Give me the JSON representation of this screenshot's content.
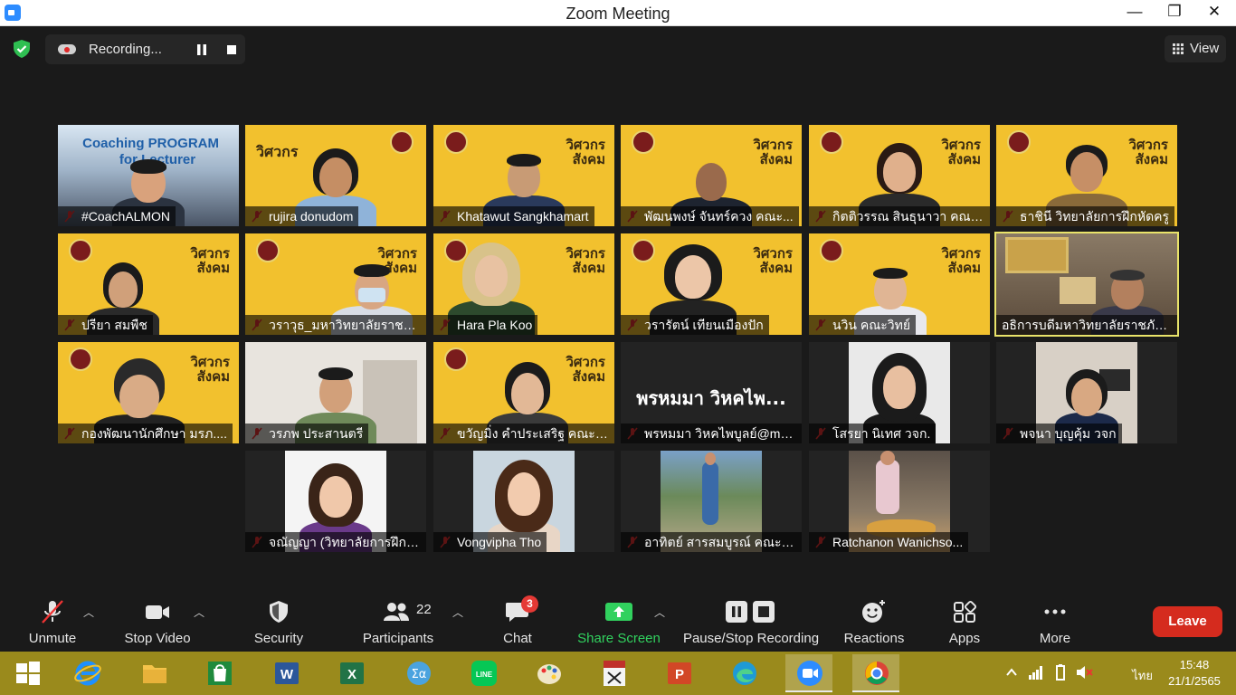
{
  "window": {
    "title": "Zoom Meeting",
    "minimize": "—",
    "maximize": "❐",
    "close": "✕"
  },
  "top": {
    "recording_label": "Recording...",
    "view_label": "View"
  },
  "tiles": [
    {
      "name": "#CoachALMON",
      "overlay1": "Coaching PROGRAM",
      "overlay2": "for Lecturer"
    },
    {
      "name": "rujira donudom"
    },
    {
      "name": "Khatawut Sangkhamart"
    },
    {
      "name": "พัฒนพงษ์ จันทร์ควง คณะ..."
    },
    {
      "name": "กิตติวรรณ สินธุนาวา คณะ..."
    },
    {
      "name": "ธาชินี วิทยาลัยการฝึกหัดครู"
    },
    {
      "name": "ปรียา สมพืช"
    },
    {
      "name": "วราวุธ_มหาวิทยาลัยราชภั..."
    },
    {
      "name": "Hara Pla Koo"
    },
    {
      "name": "วรารัตน์ เทียนเมืองปัก"
    },
    {
      "name": "นวิน คณะวิทย์"
    },
    {
      "name": "อธิการบดีมหาวิทยาลัยราชภัฏ..."
    },
    {
      "name": "กองพัฒนานักศึกษา มรภ...."
    },
    {
      "name": "วรภพ ประสานตรี"
    },
    {
      "name": "ขวัญมิ่ง คำประเสริฐ คณะวิ..."
    },
    {
      "name": "พรหมมา วิหคไพบูลย์@ma...",
      "big": "พรหมมา วิหคไพ..."
    },
    {
      "name": "โสรยา นิเทศ วจก."
    },
    {
      "name": "พจนา บุญคุ้ม วจก"
    },
    {
      "name": "จณัญญา (วิทยาลัยการฝึกหั..."
    },
    {
      "name": "Vongvipha Tho"
    },
    {
      "name": "อาทิตย์ สารสมบูรณ์ คณะวิ..."
    },
    {
      "name": "Ratchanon Wanichso..."
    }
  ],
  "logo_text": {
    "line1": "วิศวกร",
    "line2": "สังคม"
  },
  "toolbar": {
    "unmute": "Unmute",
    "stop_video": "Stop Video",
    "security": "Security",
    "participants": "Participants",
    "participants_count": "22",
    "chat": "Chat",
    "chat_badge": "3",
    "share_screen": "Share Screen",
    "pause_stop_recording": "Pause/Stop Recording",
    "reactions": "Reactions",
    "apps": "Apps",
    "more": "More",
    "leave": "Leave"
  },
  "taskbar": {
    "lang": "ไทย",
    "time": "15:48",
    "date": "21/1/2565",
    "apps": [
      "start",
      "internet-explorer",
      "file-explorer",
      "store",
      "word",
      "excel",
      "calculator",
      "line",
      "paint",
      "lisrel",
      "powerpoint",
      "edge",
      "zoom",
      "chrome"
    ]
  },
  "colors": {
    "accent_green": "#31d15e",
    "leave_red": "#d52b1e",
    "taskbar": "#9a8a1c",
    "tile_yellow": "#f2c12e",
    "active_border": "#e9e36a"
  }
}
